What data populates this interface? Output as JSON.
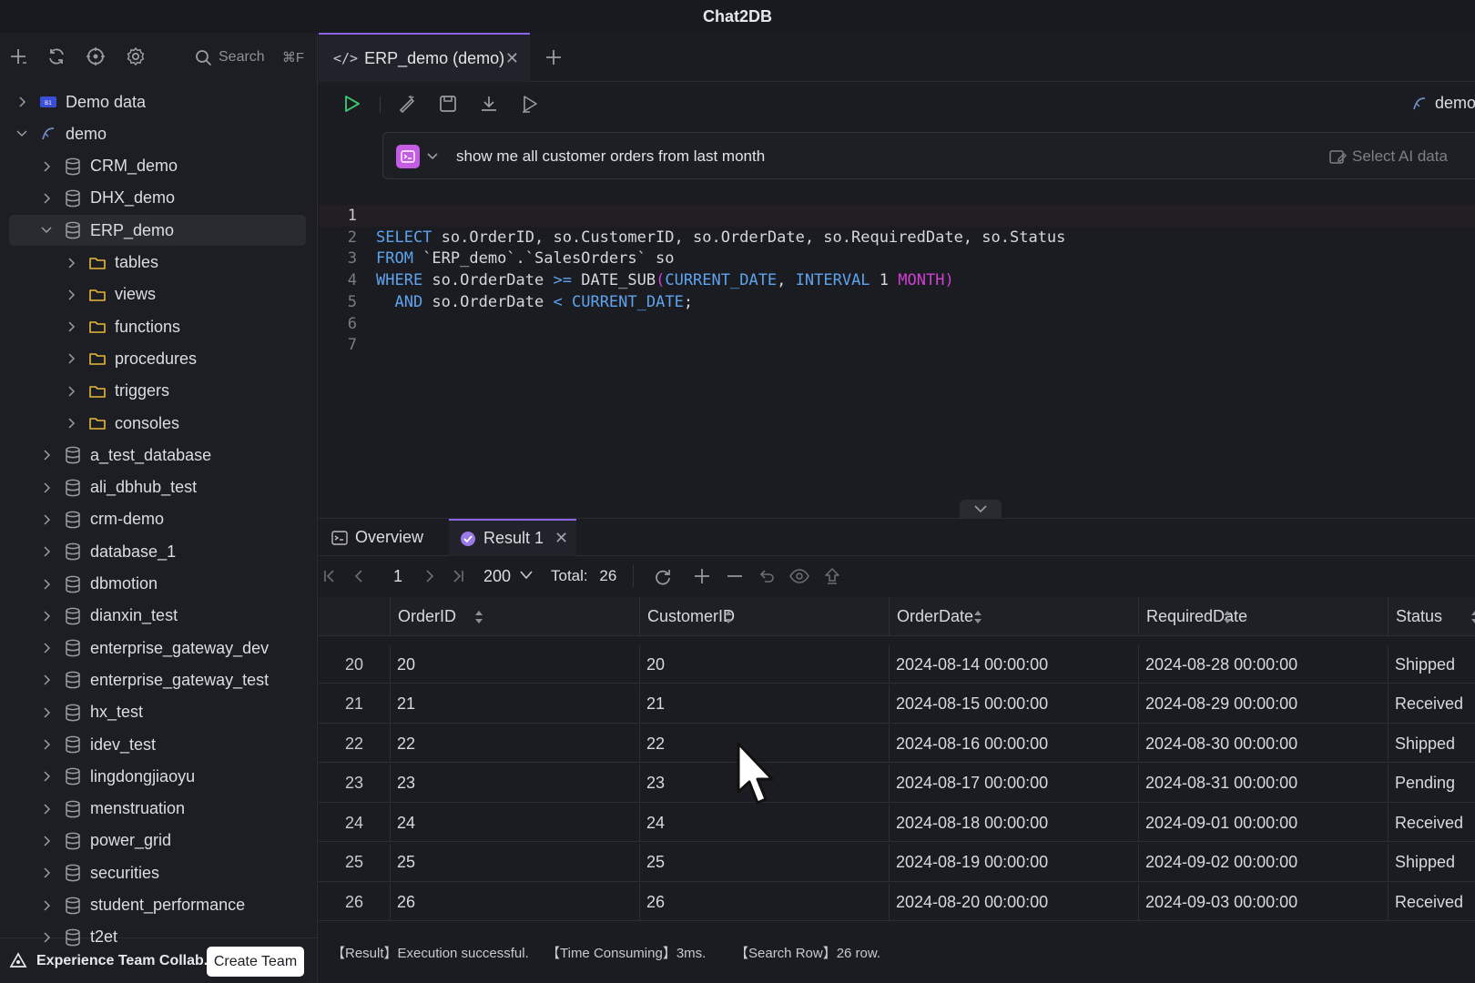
{
  "app": {
    "title": "Chat2DB"
  },
  "sidebar": {
    "toolbar": {
      "icons": [
        "add-icon",
        "refresh-icon",
        "locate-icon",
        "gear-icon"
      ],
      "search_label": "Search",
      "search_shortcut": "⌘F"
    },
    "tree": [
      {
        "label": "Demo data",
        "type": "connection",
        "level": 0,
        "expanded": false
      },
      {
        "label": "demo",
        "type": "connection",
        "level": 0,
        "expanded": true
      },
      {
        "label": "CRM_demo",
        "type": "database",
        "level": 1,
        "expanded": false
      },
      {
        "label": "DHX_demo",
        "type": "database",
        "level": 1,
        "expanded": false
      },
      {
        "label": "ERP_demo",
        "type": "database",
        "level": 1,
        "expanded": true,
        "selected": true
      },
      {
        "label": "tables",
        "type": "folder",
        "level": 2,
        "expanded": false
      },
      {
        "label": "views",
        "type": "folder",
        "level": 2,
        "expanded": false
      },
      {
        "label": "functions",
        "type": "folder",
        "level": 2,
        "expanded": false
      },
      {
        "label": "procedures",
        "type": "folder",
        "level": 2,
        "expanded": false
      },
      {
        "label": "triggers",
        "type": "folder",
        "level": 2,
        "expanded": false
      },
      {
        "label": "consoles",
        "type": "folder",
        "level": 2,
        "expanded": false
      },
      {
        "label": "a_test_database",
        "type": "database",
        "level": 1,
        "expanded": false
      },
      {
        "label": "ali_dbhub_test",
        "type": "database",
        "level": 1,
        "expanded": false
      },
      {
        "label": "crm-demo",
        "type": "database",
        "level": 1,
        "expanded": false
      },
      {
        "label": "database_1",
        "type": "database",
        "level": 1,
        "expanded": false
      },
      {
        "label": "dbmotion",
        "type": "database",
        "level": 1,
        "expanded": false
      },
      {
        "label": "dianxin_test",
        "type": "database",
        "level": 1,
        "expanded": false
      },
      {
        "label": "enterprise_gateway_dev",
        "type": "database",
        "level": 1,
        "expanded": false
      },
      {
        "label": "enterprise_gateway_test",
        "type": "database",
        "level": 1,
        "expanded": false
      },
      {
        "label": "hx_test",
        "type": "database",
        "level": 1,
        "expanded": false
      },
      {
        "label": "idev_test",
        "type": "database",
        "level": 1,
        "expanded": false
      },
      {
        "label": "lingdongjiaoyu",
        "type": "database",
        "level": 1,
        "expanded": false
      },
      {
        "label": "menstruation",
        "type": "database",
        "level": 1,
        "expanded": false
      },
      {
        "label": "power_grid",
        "type": "database",
        "level": 1,
        "expanded": false
      },
      {
        "label": "securities",
        "type": "database",
        "level": 1,
        "expanded": false
      },
      {
        "label": "student_performance",
        "type": "database",
        "level": 1,
        "expanded": false
      },
      {
        "label": "t2et",
        "type": "database",
        "level": 1,
        "expanded": false
      }
    ],
    "footer": {
      "team_text": "Experience Team Collab...",
      "create_team_label": "Create Team"
    }
  },
  "editor": {
    "tab": {
      "code_glyph": "</>",
      "label": "ERP_demo (demo)"
    },
    "toolbar_icons": [
      "run-icon",
      "format-icon",
      "save-icon",
      "download-icon",
      "run-selected-icon"
    ],
    "database_label": "demo",
    "ai": {
      "prompt": "show me all customer orders from last month",
      "select_label": "Select AI data"
    },
    "lines": [
      {
        "n": "1",
        "tokens": []
      },
      {
        "n": "2",
        "tokens": [
          {
            "t": "SELECT",
            "c": "kw"
          },
          {
            "t": " so.OrderID, so.CustomerID, so.OrderDate, so.RequiredDate, so.Status",
            "c": "tx"
          }
        ]
      },
      {
        "n": "3",
        "tokens": [
          {
            "t": "FROM",
            "c": "kw"
          },
          {
            "t": " `ERP_demo`.`SalesOrders` so",
            "c": "tx"
          }
        ]
      },
      {
        "n": "4",
        "tokens": [
          {
            "t": "WHERE",
            "c": "kw"
          },
          {
            "t": " so.OrderDate ",
            "c": "tx"
          },
          {
            "t": ">=",
            "c": "op"
          },
          {
            "t": " DATE_SUB",
            "c": "tx"
          },
          {
            "t": "(",
            "c": "mg"
          },
          {
            "t": "CURRENT_DATE",
            "c": "kw"
          },
          {
            "t": ", ",
            "c": "tx"
          },
          {
            "t": "INTERVAL",
            "c": "kw"
          },
          {
            "t": " 1 ",
            "c": "tx"
          },
          {
            "t": "MONTH",
            "c": "mg"
          },
          {
            "t": ")",
            "c": "mg"
          }
        ]
      },
      {
        "n": "5",
        "tokens": [
          {
            "t": "  AND",
            "c": "kw"
          },
          {
            "t": " so.OrderDate ",
            "c": "tx"
          },
          {
            "t": "<",
            "c": "op"
          },
          {
            "t": " ",
            "c": "tx"
          },
          {
            "t": "CURRENT_DATE",
            "c": "kw"
          },
          {
            "t": ";",
            "c": "tx"
          }
        ]
      },
      {
        "n": "6",
        "tokens": []
      },
      {
        "n": "7",
        "tokens": []
      }
    ]
  },
  "results": {
    "tabs": {
      "overview": "Overview",
      "result": "Result 1"
    },
    "pager": {
      "page": "1",
      "page_size": "200",
      "total_label": "Total:",
      "total": "26"
    },
    "columns": [
      "OrderID",
      "CustomerID",
      "OrderDate",
      "RequiredDate",
      "Status"
    ],
    "rows": [
      {
        "idx": "20",
        "cells": [
          "20",
          "20",
          "2024-08-14 00:00:00",
          "2024-08-28 00:00:00",
          "Shipped"
        ]
      },
      {
        "idx": "21",
        "cells": [
          "21",
          "21",
          "2024-08-15 00:00:00",
          "2024-08-29 00:00:00",
          "Received"
        ]
      },
      {
        "idx": "22",
        "cells": [
          "22",
          "22",
          "2024-08-16 00:00:00",
          "2024-08-30 00:00:00",
          "Shipped"
        ]
      },
      {
        "idx": "23",
        "cells": [
          "23",
          "23",
          "2024-08-17 00:00:00",
          "2024-08-31 00:00:00",
          "Pending"
        ]
      },
      {
        "idx": "24",
        "cells": [
          "24",
          "24",
          "2024-08-18 00:00:00",
          "2024-09-01 00:00:00",
          "Received"
        ]
      },
      {
        "idx": "25",
        "cells": [
          "25",
          "25",
          "2024-08-19 00:00:00",
          "2024-09-02 00:00:00",
          "Shipped"
        ]
      },
      {
        "idx": "26",
        "cells": [
          "26",
          "26",
          "2024-08-20 00:00:00",
          "2024-09-03 00:00:00",
          "Received"
        ]
      }
    ],
    "status": {
      "result": "【Result】Execution successful.",
      "time": "【Time Consuming】3ms.",
      "rows": "【Search Row】26 row."
    }
  },
  "colors": {
    "accent": "#8d64e8",
    "keyword": "#5ea3ee",
    "magenta": "#d23fd6",
    "run_green": "#3ec46d",
    "folder_yellow": "#e8b73a",
    "ai_badge": "#c55ce6"
  }
}
